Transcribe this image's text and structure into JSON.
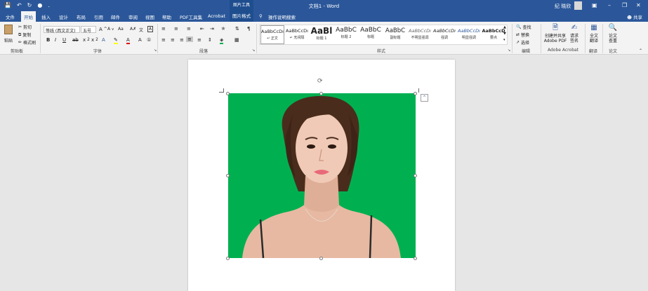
{
  "titlebar": {
    "document_title": "文档1 - Word",
    "context_tools_title": "图片工具",
    "user_name": "纪 晓欣",
    "quick_access": [
      "save-icon",
      "undo-icon",
      "redo-icon",
      "autosave-icon",
      "customize-icon"
    ],
    "window_controls": [
      "ribbon-display-icon",
      "minimize-icon",
      "restore-icon",
      "close-icon"
    ]
  },
  "tabs": {
    "items": [
      "文件",
      "开始",
      "插入",
      "设计",
      "布局",
      "引用",
      "邮件",
      "审阅",
      "视图",
      "帮助",
      "PDF工具集",
      "Acrobat",
      "图片格式"
    ],
    "active": "开始",
    "tell_me": "操作说明搜索",
    "share": "共享"
  },
  "ribbon": {
    "clipboard": {
      "paste": "粘贴",
      "cut": "剪切",
      "copy": "复制",
      "format_painter": "格式刷",
      "label": "剪贴板"
    },
    "font": {
      "family": "等线 (西文正文)",
      "size": "五号",
      "label": "字体"
    },
    "paragraph": {
      "label": "段落"
    },
    "styles": {
      "label": "样式",
      "items": [
        {
          "sample": "AaBbCcDı",
          "name": "↵ 正文"
        },
        {
          "sample": "AaBbCcDı",
          "name": "↵ 无间隔"
        },
        {
          "sample": "AaBl",
          "name": "标题 1"
        },
        {
          "sample": "AaBbC",
          "name": "标题 2"
        },
        {
          "sample": "AaBbC",
          "name": "标题"
        },
        {
          "sample": "AaBbC",
          "name": "副标题"
        },
        {
          "sample": "AaBbCcDı",
          "name": "不明显强调"
        },
        {
          "sample": "AaBbCcDı",
          "name": "强调"
        },
        {
          "sample": "AaBbCcDı",
          "name": "明显强调"
        },
        {
          "sample": "AaBbCcD",
          "name": "要点"
        }
      ]
    },
    "editing": {
      "find": "查找",
      "replace": "替换",
      "select": "选择",
      "label": "编辑"
    },
    "acrobat": {
      "create_share": "创建并共享\nAdobe PDF",
      "request_sign": "请求\n签名",
      "label": "Adobe Acrobat"
    },
    "translate": {
      "full_translate": "全文\n翻译",
      "label": "翻译"
    },
    "paper": {
      "check": "论文\n查重",
      "label": "论文"
    }
  },
  "colors": {
    "brand_blue": "#2b579a",
    "photo_background": "#00b050"
  }
}
